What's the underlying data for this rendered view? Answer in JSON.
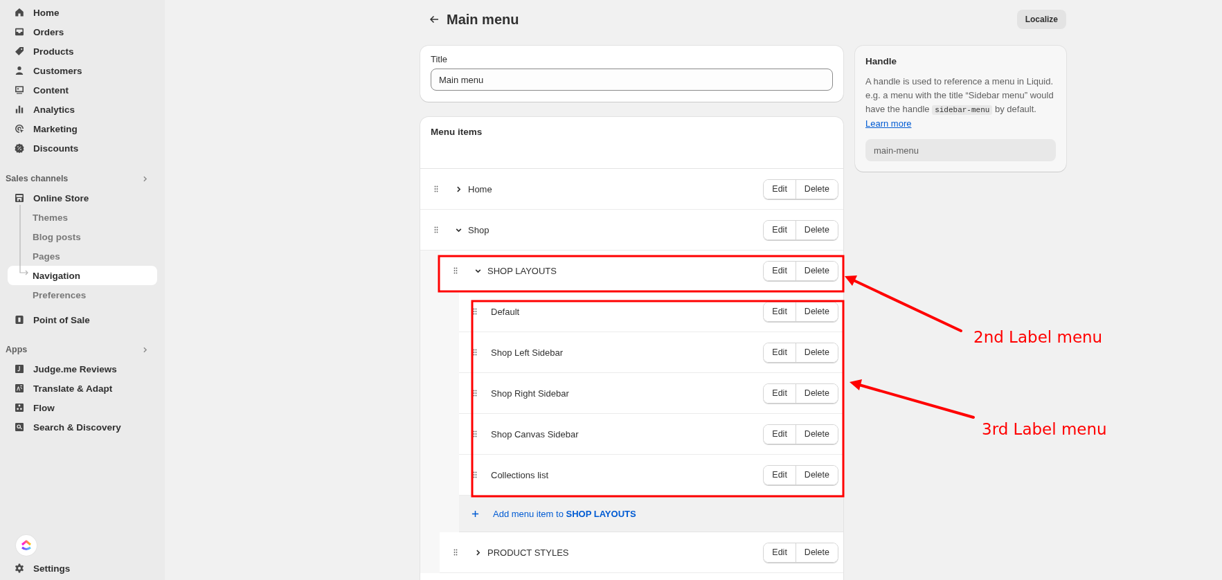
{
  "sidebar": {
    "main_items": [
      {
        "label": "Home",
        "selected": false
      },
      {
        "label": "Orders",
        "selected": false
      },
      {
        "label": "Products",
        "selected": false
      },
      {
        "label": "Customers",
        "selected": false
      },
      {
        "label": "Content",
        "selected": false
      },
      {
        "label": "Analytics",
        "selected": false
      },
      {
        "label": "Marketing",
        "selected": false
      },
      {
        "label": "Discounts",
        "selected": false
      }
    ],
    "sales_channels": {
      "heading": "Sales channels",
      "items": [
        {
          "label": "Online Store",
          "selected": false,
          "children": [
            {
              "label": "Themes",
              "selected": false
            },
            {
              "label": "Blog posts",
              "selected": false
            },
            {
              "label": "Pages",
              "selected": false
            },
            {
              "label": "Navigation",
              "selected": true
            },
            {
              "label": "Preferences",
              "selected": false
            }
          ]
        },
        {
          "label": "Point of Sale",
          "selected": false
        }
      ]
    },
    "apps": {
      "heading": "Apps",
      "items": [
        {
          "label": "Judge.me Reviews",
          "selected": false
        },
        {
          "label": "Translate & Adapt",
          "selected": false
        },
        {
          "label": "Flow",
          "selected": false
        },
        {
          "label": "Search & Discovery",
          "selected": false
        }
      ]
    },
    "settings": {
      "label": "Settings"
    }
  },
  "page": {
    "title": "Main menu",
    "localize_button": "Localize"
  },
  "title_card": {
    "label": "Title",
    "value": "Main menu"
  },
  "menu_items": {
    "heading": "Menu items",
    "items": [
      {
        "label": "Home",
        "expanded": false,
        "buttons": [
          "Edit",
          "Delete"
        ]
      },
      {
        "label": "Shop",
        "expanded": true,
        "buttons": [
          "Edit",
          "Delete"
        ],
        "children": [
          {
            "label": "SHOP LAYOUTS",
            "expanded": true,
            "buttons": [
              "Edit",
              "Delete"
            ],
            "add_item": "Add menu item to **SHOP LAYOUTS**",
            "children": [
              {
                "label": "Default",
                "buttons": [
                  "Edit",
                  "Delete"
                ]
              },
              {
                "label": "Shop Left Sidebar",
                "buttons": [
                  "Edit",
                  "Delete"
                ]
              },
              {
                "label": "Shop Right Sidebar",
                "buttons": [
                  "Edit",
                  "Delete"
                ]
              },
              {
                "label": "Shop Canvas Sidebar",
                "buttons": [
                  "Edit",
                  "Delete"
                ]
              },
              {
                "label": "Collections list",
                "buttons": [
                  "Edit",
                  "Delete"
                ]
              }
            ]
          },
          {
            "label": "PRODUCT STYLES",
            "expanded": false,
            "buttons": [
              "Edit",
              "Delete"
            ]
          }
        ]
      }
    ]
  },
  "handle_card": {
    "heading": "Handle",
    "text_before": "A handle is used to reference a menu in Liquid. e.g. a menu with the title “Sidebar menu” would have the handle",
    "code": "sidebar-menu",
    "text_after": "by default.",
    "link": "Learn more",
    "value": "main-menu"
  },
  "annotations": [
    {
      "text": "2nd Label menu"
    },
    {
      "text": "3rd Label menu"
    }
  ]
}
